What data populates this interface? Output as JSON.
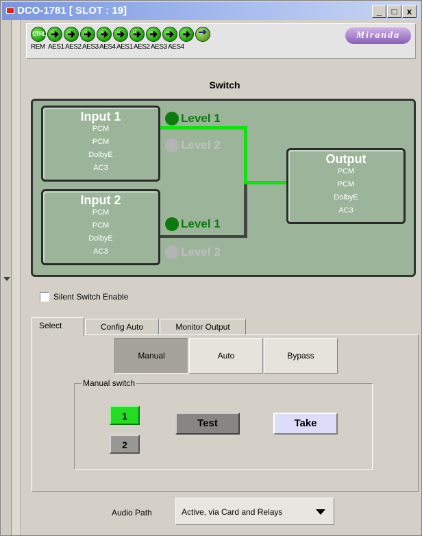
{
  "window": {
    "title": "DCO-1781 [ SLOT : 19]",
    "min_label": "_",
    "max_label": "□",
    "close_label": "x"
  },
  "status_bar": {
    "logo": "Miranda",
    "ctrl_label": "CTRL",
    "labels": [
      "REM",
      "AES1",
      "AES2",
      "AES3",
      "AES4",
      "AES1",
      "AES2",
      "AES3",
      "AES4"
    ]
  },
  "switch_panel": {
    "title": "Switch",
    "input1": {
      "title": "Input 1",
      "lines": [
        "PCM",
        "PCM",
        "DolbyE",
        "AC3"
      ]
    },
    "input2": {
      "title": "Input 2",
      "lines": [
        "PCM",
        "PCM",
        "DolbyE",
        "AC3"
      ]
    },
    "output": {
      "title": "Output",
      "lines": [
        "PCM",
        "PCM",
        "DolbyE",
        "AC3"
      ]
    },
    "levels": [
      {
        "label": "Level 1",
        "state": "on"
      },
      {
        "label": "Level 2",
        "state": "off"
      },
      {
        "label": "Level 1",
        "state": "on"
      },
      {
        "label": "Level 2",
        "state": "off"
      }
    ],
    "colors": {
      "active_path": "#11e011",
      "panel_bg": "#9cb59a"
    }
  },
  "silent_switch": {
    "label": "Silent Switch Enable",
    "checked": false
  },
  "tabs": [
    {
      "label": "Select",
      "active": true
    },
    {
      "label": "Config Auto",
      "active": false
    },
    {
      "label": "Monitor Output",
      "active": false
    }
  ],
  "mode_buttons": [
    {
      "label": "Manual",
      "pressed": true
    },
    {
      "label": "Auto",
      "pressed": false
    },
    {
      "label": "Bypass",
      "pressed": false
    }
  ],
  "manual_switch": {
    "group_label": "Manual switch",
    "input1_label": "1",
    "input2_label": "2",
    "selected": "1",
    "test_label": "Test",
    "take_label": "Take"
  },
  "footer": {
    "audio_path_label": "Audio Path",
    "audio_path_value": "Active, via Card and Relays"
  }
}
